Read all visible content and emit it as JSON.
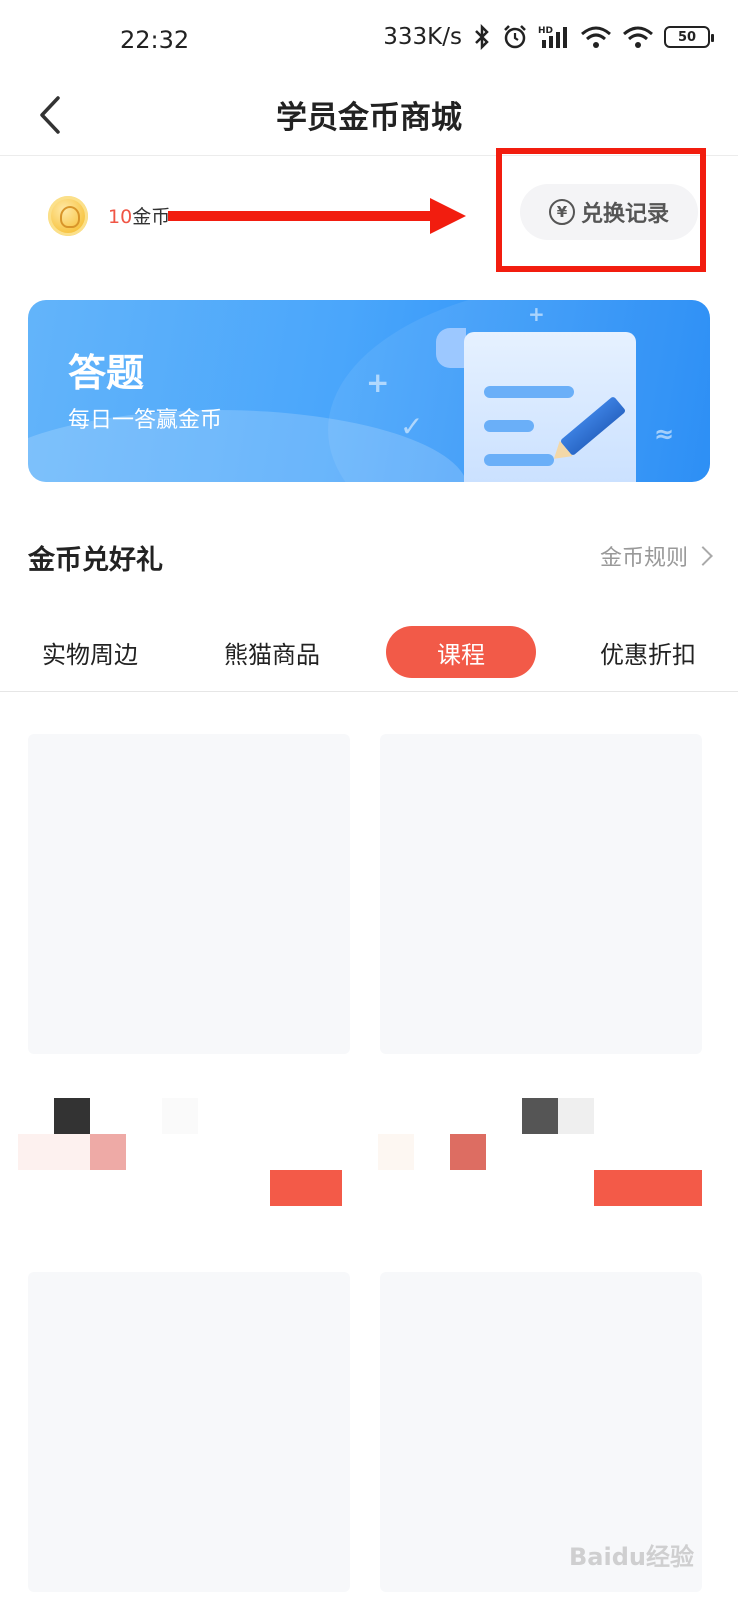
{
  "status_bar": {
    "time": "22:32",
    "net_speed": "333K/s",
    "battery": "50",
    "hd_label": "HD"
  },
  "nav": {
    "title": "学员金币商城"
  },
  "coins": {
    "count": "10",
    "unit": "金币"
  },
  "record_button": {
    "label": "兑换记录"
  },
  "banner": {
    "title": "答题",
    "subtitle": "每日一答赢金币"
  },
  "section": {
    "title": "金币兑好礼",
    "rules_label": "金币规则"
  },
  "tabs": [
    {
      "label": "实物周边",
      "active": false
    },
    {
      "label": "熊猫商品",
      "active": false
    },
    {
      "label": "课程",
      "active": true
    },
    {
      "label": "优惠折扣",
      "active": false
    }
  ],
  "colors": {
    "accent": "#f25a48",
    "annotation_red": "#f21d0f",
    "banner_blue": "#4aa6fb"
  },
  "watermark": "Baidu经验"
}
